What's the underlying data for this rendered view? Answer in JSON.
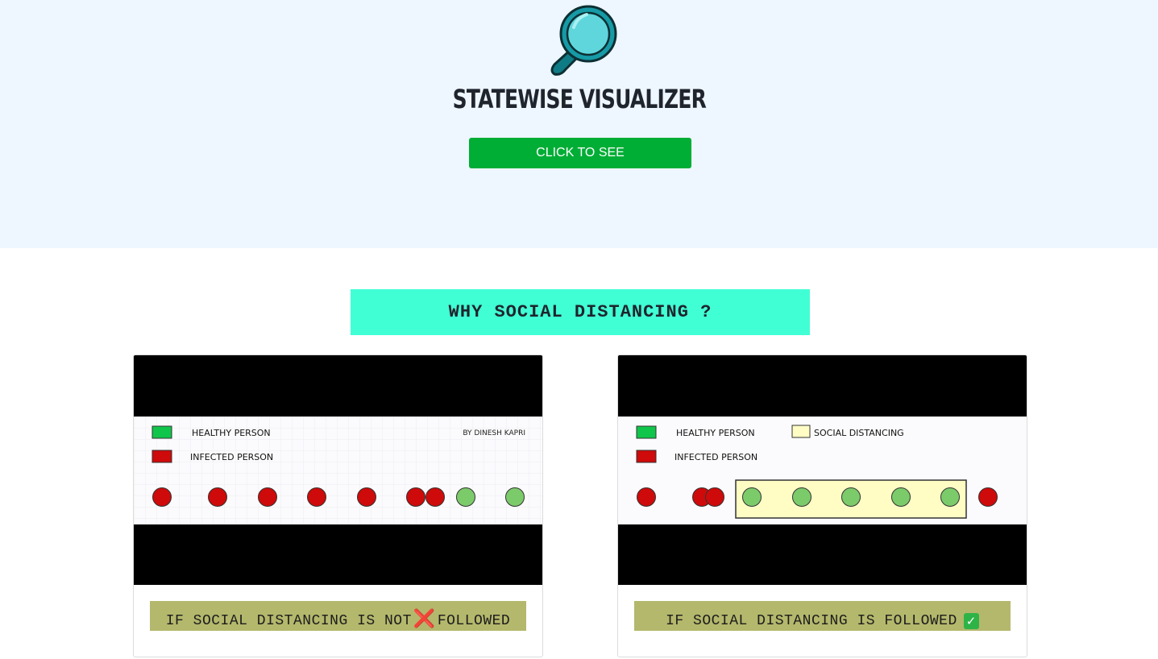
{
  "hero": {
    "logo_icon": "magnifier-icon",
    "title": "STATEWISE VISUALIZER",
    "cta_label": "CLICK TO SEE",
    "background": "#eef6ff",
    "cta_color": "#00ad35"
  },
  "section": {
    "heading": "WHY SOCIAL DISTANCING ?",
    "heading_bg": "#41ffd5"
  },
  "cards": [
    {
      "legend_healthy": "HEALTHY PERSON",
      "legend_infected": "INFECTED PERSON",
      "credit": "BY DINESH KAPRI",
      "caption": "IF SOCIAL DISTANCING IS NOT",
      "caption_tail": "FOLLOWED",
      "mark_icon": "cross-mark-icon",
      "mark": "❌"
    },
    {
      "legend_healthy": "HEALTHY PERSON",
      "legend_infected": "INFECTED PERSON",
      "legend_distancing": "SOCIAL DISTANCING",
      "caption": "IF SOCIAL DISTANCING IS FOLLOWED",
      "mark_icon": "check-mark-icon",
      "mark": "✓"
    }
  ],
  "colors": {
    "healthy": "#7ccb6b",
    "infected": "#cf0a0a",
    "distancing_zone": "#fffcc4",
    "caption_bg": "#b4b86c"
  }
}
